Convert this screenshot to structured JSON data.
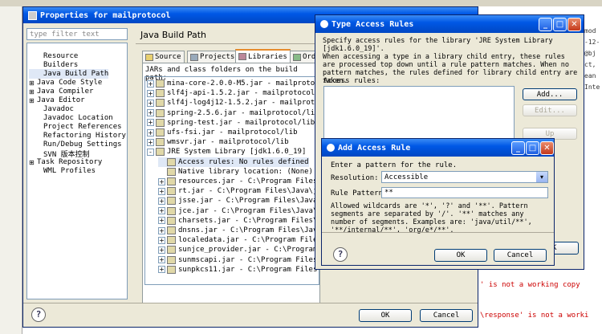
{
  "props": {
    "title": "Properties for mailprotocol",
    "filter_placeholder": "type filter text",
    "section_title": "Java Build Path",
    "nav": [
      {
        "label": "Resource",
        "exp": ""
      },
      {
        "label": "Builders",
        "exp": ""
      },
      {
        "label": "Java Build Path",
        "exp": "",
        "sel": true
      },
      {
        "label": "Java Code Style",
        "exp": "+"
      },
      {
        "label": "Java Compiler",
        "exp": "+"
      },
      {
        "label": "Java Editor",
        "exp": "+"
      },
      {
        "label": "Javadoc",
        "exp": ""
      },
      {
        "label": "Javadoc Location",
        "exp": ""
      },
      {
        "label": "Project References",
        "exp": ""
      },
      {
        "label": "Refactoring History",
        "exp": ""
      },
      {
        "label": "Run/Debug Settings",
        "exp": ""
      },
      {
        "label": "SVN 版本控制",
        "exp": ""
      },
      {
        "label": "Task Repository",
        "exp": "+"
      },
      {
        "label": "WML Profiles",
        "exp": ""
      }
    ],
    "tabs": [
      "Source",
      "Projects",
      "Libraries",
      "Ord"
    ],
    "jars_label": "JARs and class folders on the build path:",
    "tree": [
      {
        "label": "mina-core-2.0.0-M5.jar - mailprotocol/l",
        "lvl": 0,
        "exp": "+"
      },
      {
        "label": "slf4j-api-1.5.2.jar - mailprotocol/lib",
        "lvl": 0,
        "exp": "+"
      },
      {
        "label": "slf4j-log4j12-1.5.2.jar - mailprotocol/l",
        "lvl": 0,
        "exp": "+"
      },
      {
        "label": "spring-2.5.6.jar - mailprotocol/lib",
        "lvl": 0,
        "exp": "+"
      },
      {
        "label": "spring-test.jar - mailprotocol/lib",
        "lvl": 0,
        "exp": "+"
      },
      {
        "label": "ufs-fsi.jar - mailprotocol/lib",
        "lvl": 0,
        "exp": "+"
      },
      {
        "label": "wmsvr.jar - mailprotocol/lib",
        "lvl": 0,
        "exp": "+"
      },
      {
        "label": "JRE System Library [jdk1.6.0_19]",
        "lvl": 0,
        "exp": "-"
      },
      {
        "label": "Access rules: No rules defined",
        "lvl": 1,
        "exp": "",
        "sel": true
      },
      {
        "label": "Native library location: (None)",
        "lvl": 1,
        "exp": ""
      },
      {
        "label": "resources.jar - C:\\Program Files\\Java",
        "lvl": 1,
        "exp": "+"
      },
      {
        "label": "rt.jar - C:\\Program Files\\Java\\jdk1.",
        "lvl": 1,
        "exp": "+"
      },
      {
        "label": "jsse.jar - C:\\Program Files\\Java\\jdk1.",
        "lvl": 1,
        "exp": "+"
      },
      {
        "label": "jce.jar - C:\\Program Files\\Java\\jdk",
        "lvl": 1,
        "exp": "+"
      },
      {
        "label": "charsets.jar - C:\\Program Files\\Java",
        "lvl": 1,
        "exp": "+"
      },
      {
        "label": "dnsns.jar - C:\\Program Files\\Java\\jd",
        "lvl": 1,
        "exp": "+"
      },
      {
        "label": "localedata.jar - C:\\Program Files\\Ja",
        "lvl": 1,
        "exp": "+"
      },
      {
        "label": "sunjce_provider.jar - C:\\Program Fil",
        "lvl": 1,
        "exp": "+"
      },
      {
        "label": "sunmscapi.jar - C:\\Program Files\\Java",
        "lvl": 1,
        "exp": "+"
      },
      {
        "label": "sunpkcs11.jar - C:\\Program Files\\Java\\jdk1.6.",
        "lvl": 1,
        "exp": "+"
      }
    ],
    "ok": "OK",
    "cancel": "Cancel",
    "help": "?"
  },
  "tar": {
    "title": "Type Access Rules",
    "desc": "Specify access rules for the library 'JRE System Library [jdk1.6.0_19]'.\nWhen accessing a type in a library child entry, these rules are processed top down until a rule pattern matches. When no pattern matches, the rules defined for library child entry are taken.",
    "rules_label": "Access rules:",
    "add": "Add...",
    "edit": "Edit...",
    "up": "Up",
    "ok": "OK",
    "help": "?"
  },
  "aar": {
    "title": "Add Access Rule",
    "prompt": "Enter a pattern for the rule.",
    "resolution_label": "Resolution:",
    "resolution_value": "Accessible",
    "pattern_label": "Rule Pattern:",
    "pattern_value": "**",
    "hint": "Allowed wildcards are '*', '?' and '**'. Pattern segments are separated by '/'. '**' matches any number of segments. Examples are: 'java/util/**', '**/internal/**', 'org/e*/**'.",
    "ok": "OK",
    "cancel": "Cancel",
    "help": "?"
  },
  "bg": {
    "right_lines": [
      "mod",
      "-12-",
      "@bj",
      "ct,",
      "ean",
      "Inte"
    ],
    "console1": "' is not a working copy",
    "console2": "\\response' is not a worki"
  }
}
